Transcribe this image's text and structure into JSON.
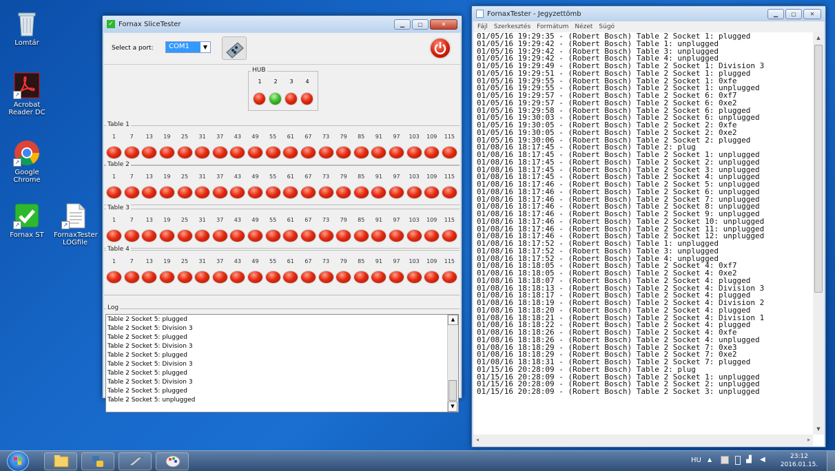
{
  "desktop": {
    "icons": [
      {
        "label": "Lomtár",
        "icon": "recycle-bin-icon"
      },
      {
        "label": "Acrobat Reader DC",
        "icon": "acrobat-icon"
      },
      {
        "label": "Google Chrome",
        "icon": "chrome-icon"
      },
      {
        "label": "Fornax ST",
        "icon": "fornax-icon"
      },
      {
        "label": "FornaxTester LOGfile",
        "icon": "text-file-icon"
      }
    ]
  },
  "app": {
    "title": "Fornax SliceTester",
    "port_label": "Select a port:",
    "port_value": "COM1",
    "hub": {
      "label": "HUB",
      "numbers": [
        "1",
        "2",
        "3",
        "4"
      ],
      "states": [
        "red",
        "green",
        "red",
        "red"
      ]
    },
    "column_numbers": [
      "1",
      "7",
      "13",
      "19",
      "25",
      "31",
      "37",
      "43",
      "49",
      "55",
      "61",
      "67",
      "73",
      "79",
      "85",
      "91",
      "97",
      "103",
      "109",
      "115"
    ],
    "tables": [
      {
        "label": "Table 1"
      },
      {
        "label": "Table 2"
      },
      {
        "label": "Table 3"
      },
      {
        "label": "Table 4"
      }
    ],
    "log_label": "Log",
    "log_lines": [
      "Table 2 Socket 5: plugged",
      "Table 2 Socket 5: Division 3",
      "Table 2 Socket 5: plugged",
      "Table 2 Socket 5: Division 3",
      "Table 2 Socket 5: plugged",
      "Table 2 Socket 5: Division 3",
      "Table 2 Socket 5: plugged",
      "Table 2 Socket 5: Division 3",
      "Table 2 Socket 5: plugged",
      "Table 2 Socket 5: unplugged"
    ]
  },
  "notepad": {
    "title": "FornaxTester - Jegyzettömb",
    "menu": [
      "Fájl",
      "Szerkesztés",
      "Formátum",
      "Nézet",
      "Súgó"
    ],
    "lines": [
      "01/05/16 19:29:35 - (Robert Bosch) Table 2 Socket 1: plugged",
      "01/05/16 19:29:42 - (Robert Bosch) Table 1: unplugged",
      "01/05/16 19:29:42 - (Robert Bosch) Table 3: unplugged",
      "01/05/16 19:29:42 - (Robert Bosch) Table 4: unplugged",
      "01/05/16 19:29:49 - (Robert Bosch) Table 2 Socket 1: Division 3",
      "01/05/16 19:29:51 - (Robert Bosch) Table 2 Socket 1: plugged",
      "01/05/16 19:29:55 - (Robert Bosch) Table 2 Socket 1: 0xfe",
      "01/05/16 19:29:55 - (Robert Bosch) Table 2 Socket 1: unplugged",
      "01/05/16 19:29:57 - (Robert Bosch) Table 2 Socket 6: 0xf7",
      "01/05/16 19:29:57 - (Robert Bosch) Table 2 Socket 6: 0xe2",
      "01/05/16 19:29:58 - (Robert Bosch) Table 2 Socket 6: plugged",
      "01/05/16 19:30:03 - (Robert Bosch) Table 2 Socket 6: unplugged",
      "01/05/16 19:30:05 - (Robert Bosch) Table 2 Socket 2: 0xfe",
      "01/05/16 19:30:05 - (Robert Bosch) Table 2 Socket 2: 0xe2",
      "01/05/16 19:30:06 - (Robert Bosch) Table 2 Socket 2: plugged",
      "01/08/16 18:17:45 - (Robert Bosch) Table 2: plug",
      "01/08/16 18:17:45 - (Robert Bosch) Table 2 Socket 1: unplugged",
      "01/08/16 18:17:45 - (Robert Bosch) Table 2 Socket 2: unplugged",
      "01/08/16 18:17:45 - (Robert Bosch) Table 2 Socket 3: unplugged",
      "01/08/16 18:17:45 - (Robert Bosch) Table 2 Socket 4: unplugged",
      "01/08/16 18:17:46 - (Robert Bosch) Table 2 Socket 5: unplugged",
      "01/08/16 18:17:46 - (Robert Bosch) Table 2 Socket 6: unplugged",
      "01/08/16 18:17:46 - (Robert Bosch) Table 2 Socket 7: unplugged",
      "01/08/16 18:17:46 - (Robert Bosch) Table 2 Socket 8: unplugged",
      "01/08/16 18:17:46 - (Robert Bosch) Table 2 Socket 9: unplugged",
      "01/08/16 18:17:46 - (Robert Bosch) Table 2 Socket 10: unplugged",
      "01/08/16 18:17:46 - (Robert Bosch) Table 2 Socket 11: unplugged",
      "01/08/16 18:17:46 - (Robert Bosch) Table 2 Socket 12: unplugged",
      "01/08/16 18:17:52 - (Robert Bosch) Table 1: unplugged",
      "01/08/16 18:17:52 - (Robert Bosch) Table 3: unplugged",
      "01/08/16 18:17:52 - (Robert Bosch) Table 4: unplugged",
      "01/08/16 18:18:05 - (Robert Bosch) Table 2 Socket 4: 0xf7",
      "01/08/16 18:18:05 - (Robert Bosch) Table 2 Socket 4: 0xe2",
      "01/08/16 18:18:07 - (Robert Bosch) Table 2 Socket 4: plugged",
      "01/08/16 18:18:13 - (Robert Bosch) Table 2 Socket 4: Division 3",
      "01/08/16 18:18:17 - (Robert Bosch) Table 2 Socket 4: plugged",
      "01/08/16 18:18:19 - (Robert Bosch) Table 2 Socket 4: Division 2",
      "01/08/16 18:18:20 - (Robert Bosch) Table 2 Socket 4: plugged",
      "01/08/16 18:18:21 - (Robert Bosch) Table 2 Socket 4: Division 1",
      "01/08/16 18:18:22 - (Robert Bosch) Table 2 Socket 4: plugged",
      "01/08/16 18:18:26 - (Robert Bosch) Table 2 Socket 4: 0xfe",
      "01/08/16 18:18:26 - (Robert Bosch) Table 2 Socket 4: unplugged",
      "01/08/16 18:18:29 - (Robert Bosch) Table 2 Socket 7: 0xe3",
      "01/08/16 18:18:29 - (Robert Bosch) Table 2 Socket 7: 0xe2",
      "01/08/16 18:18:31 - (Robert Bosch) Table 2 Socket 7: plugged",
      "01/15/16 20:28:09 - (Robert Bosch) Table 2: plug",
      "01/15/16 20:28:09 - (Robert Bosch) Table 2 Socket 1: unplugged",
      "01/15/16 20:28:09 - (Robert Bosch) Table 2 Socket 2: unplugged",
      "01/15/16 20:28:09 - (Robert Bosch) Table 2 Socket 3: unplugged"
    ]
  },
  "taskbar": {
    "items": [
      "start-orb-icon",
      "explorer-icon",
      "python-icon",
      "vmware-icon",
      "paint-icon"
    ],
    "lang": "HU",
    "time": "23:12",
    "date": "2016.01.15."
  },
  "colors": {
    "led_red": "#e52c12",
    "led_green": "#3ebd2a",
    "desktop": "#1768c9"
  }
}
